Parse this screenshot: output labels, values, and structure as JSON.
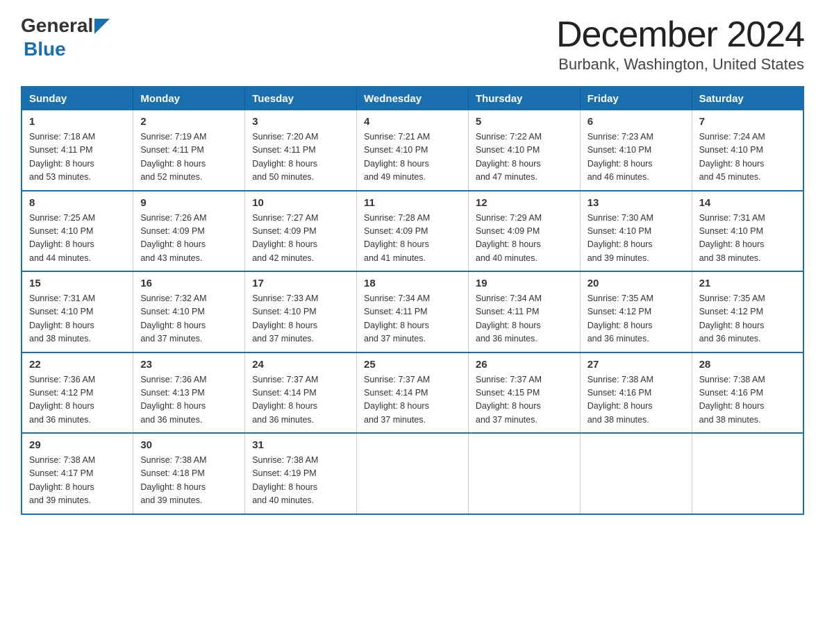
{
  "header": {
    "logo_general": "General",
    "logo_blue": "Blue",
    "title": "December 2024",
    "subtitle": "Burbank, Washington, United States"
  },
  "weekdays": [
    "Sunday",
    "Monday",
    "Tuesday",
    "Wednesday",
    "Thursday",
    "Friday",
    "Saturday"
  ],
  "weeks": [
    [
      {
        "day": "1",
        "sunrise": "7:18 AM",
        "sunset": "4:11 PM",
        "daylight": "8 hours and 53 minutes."
      },
      {
        "day": "2",
        "sunrise": "7:19 AM",
        "sunset": "4:11 PM",
        "daylight": "8 hours and 52 minutes."
      },
      {
        "day": "3",
        "sunrise": "7:20 AM",
        "sunset": "4:11 PM",
        "daylight": "8 hours and 50 minutes."
      },
      {
        "day": "4",
        "sunrise": "7:21 AM",
        "sunset": "4:10 PM",
        "daylight": "8 hours and 49 minutes."
      },
      {
        "day": "5",
        "sunrise": "7:22 AM",
        "sunset": "4:10 PM",
        "daylight": "8 hours and 47 minutes."
      },
      {
        "day": "6",
        "sunrise": "7:23 AM",
        "sunset": "4:10 PM",
        "daylight": "8 hours and 46 minutes."
      },
      {
        "day": "7",
        "sunrise": "7:24 AM",
        "sunset": "4:10 PM",
        "daylight": "8 hours and 45 minutes."
      }
    ],
    [
      {
        "day": "8",
        "sunrise": "7:25 AM",
        "sunset": "4:10 PM",
        "daylight": "8 hours and 44 minutes."
      },
      {
        "day": "9",
        "sunrise": "7:26 AM",
        "sunset": "4:09 PM",
        "daylight": "8 hours and 43 minutes."
      },
      {
        "day": "10",
        "sunrise": "7:27 AM",
        "sunset": "4:09 PM",
        "daylight": "8 hours and 42 minutes."
      },
      {
        "day": "11",
        "sunrise": "7:28 AM",
        "sunset": "4:09 PM",
        "daylight": "8 hours and 41 minutes."
      },
      {
        "day": "12",
        "sunrise": "7:29 AM",
        "sunset": "4:09 PM",
        "daylight": "8 hours and 40 minutes."
      },
      {
        "day": "13",
        "sunrise": "7:30 AM",
        "sunset": "4:10 PM",
        "daylight": "8 hours and 39 minutes."
      },
      {
        "day": "14",
        "sunrise": "7:31 AM",
        "sunset": "4:10 PM",
        "daylight": "8 hours and 38 minutes."
      }
    ],
    [
      {
        "day": "15",
        "sunrise": "7:31 AM",
        "sunset": "4:10 PM",
        "daylight": "8 hours and 38 minutes."
      },
      {
        "day": "16",
        "sunrise": "7:32 AM",
        "sunset": "4:10 PM",
        "daylight": "8 hours and 37 minutes."
      },
      {
        "day": "17",
        "sunrise": "7:33 AM",
        "sunset": "4:10 PM",
        "daylight": "8 hours and 37 minutes."
      },
      {
        "day": "18",
        "sunrise": "7:34 AM",
        "sunset": "4:11 PM",
        "daylight": "8 hours and 37 minutes."
      },
      {
        "day": "19",
        "sunrise": "7:34 AM",
        "sunset": "4:11 PM",
        "daylight": "8 hours and 36 minutes."
      },
      {
        "day": "20",
        "sunrise": "7:35 AM",
        "sunset": "4:12 PM",
        "daylight": "8 hours and 36 minutes."
      },
      {
        "day": "21",
        "sunrise": "7:35 AM",
        "sunset": "4:12 PM",
        "daylight": "8 hours and 36 minutes."
      }
    ],
    [
      {
        "day": "22",
        "sunrise": "7:36 AM",
        "sunset": "4:12 PM",
        "daylight": "8 hours and 36 minutes."
      },
      {
        "day": "23",
        "sunrise": "7:36 AM",
        "sunset": "4:13 PM",
        "daylight": "8 hours and 36 minutes."
      },
      {
        "day": "24",
        "sunrise": "7:37 AM",
        "sunset": "4:14 PM",
        "daylight": "8 hours and 36 minutes."
      },
      {
        "day": "25",
        "sunrise": "7:37 AM",
        "sunset": "4:14 PM",
        "daylight": "8 hours and 37 minutes."
      },
      {
        "day": "26",
        "sunrise": "7:37 AM",
        "sunset": "4:15 PM",
        "daylight": "8 hours and 37 minutes."
      },
      {
        "day": "27",
        "sunrise": "7:38 AM",
        "sunset": "4:16 PM",
        "daylight": "8 hours and 38 minutes."
      },
      {
        "day": "28",
        "sunrise": "7:38 AM",
        "sunset": "4:16 PM",
        "daylight": "8 hours and 38 minutes."
      }
    ],
    [
      {
        "day": "29",
        "sunrise": "7:38 AM",
        "sunset": "4:17 PM",
        "daylight": "8 hours and 39 minutes."
      },
      {
        "day": "30",
        "sunrise": "7:38 AM",
        "sunset": "4:18 PM",
        "daylight": "8 hours and 39 minutes."
      },
      {
        "day": "31",
        "sunrise": "7:38 AM",
        "sunset": "4:19 PM",
        "daylight": "8 hours and 40 minutes."
      },
      null,
      null,
      null,
      null
    ]
  ]
}
